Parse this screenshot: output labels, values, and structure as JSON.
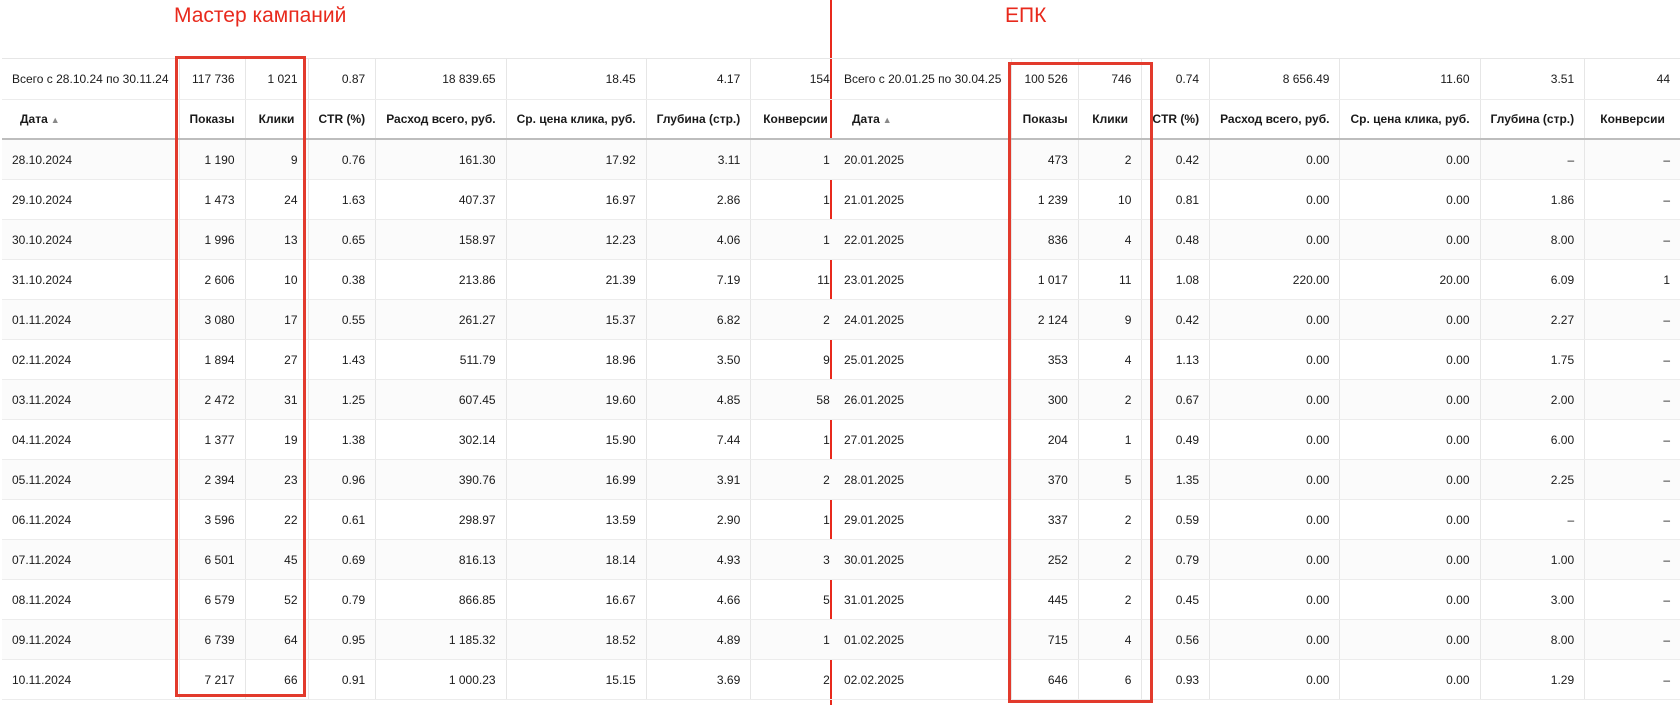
{
  "left": {
    "title": "Мастер кампаний",
    "total": {
      "label": "Всего с 28.10.24 по 30.11.24",
      "values": [
        "117 736",
        "1 021",
        "0.87",
        "18 839.65",
        "18.45",
        "4.17",
        "154"
      ]
    },
    "headers": [
      "Дата",
      "Показы",
      "Клики",
      "CTR (%)",
      "Расход всего, руб.",
      "Ср. цена клика, руб.",
      "Глубина (стр.)",
      "Конверсии"
    ],
    "rows": [
      [
        "28.10.2024",
        "1 190",
        "9",
        "0.76",
        "161.30",
        "17.92",
        "3.11",
        "1"
      ],
      [
        "29.10.2024",
        "1 473",
        "24",
        "1.63",
        "407.37",
        "16.97",
        "2.86",
        "1"
      ],
      [
        "30.10.2024",
        "1 996",
        "13",
        "0.65",
        "158.97",
        "12.23",
        "4.06",
        "1"
      ],
      [
        "31.10.2024",
        "2 606",
        "10",
        "0.38",
        "213.86",
        "21.39",
        "7.19",
        "11"
      ],
      [
        "01.11.2024",
        "3 080",
        "17",
        "0.55",
        "261.27",
        "15.37",
        "6.82",
        "2"
      ],
      [
        "02.11.2024",
        "1 894",
        "27",
        "1.43",
        "511.79",
        "18.96",
        "3.50",
        "9"
      ],
      [
        "03.11.2024",
        "2 472",
        "31",
        "1.25",
        "607.45",
        "19.60",
        "4.85",
        "58"
      ],
      [
        "04.11.2024",
        "1 377",
        "19",
        "1.38",
        "302.14",
        "15.90",
        "7.44",
        "1"
      ],
      [
        "05.11.2024",
        "2 394",
        "23",
        "0.96",
        "390.76",
        "16.99",
        "3.91",
        "2"
      ],
      [
        "06.11.2024",
        "3 596",
        "22",
        "0.61",
        "298.97",
        "13.59",
        "2.90",
        "1"
      ],
      [
        "07.11.2024",
        "6 501",
        "45",
        "0.69",
        "816.13",
        "18.14",
        "4.93",
        "3"
      ],
      [
        "08.11.2024",
        "6 579",
        "52",
        "0.79",
        "866.85",
        "16.67",
        "4.66",
        "5"
      ],
      [
        "09.11.2024",
        "6 739",
        "64",
        "0.95",
        "1 185.32",
        "18.52",
        "4.89",
        "1"
      ],
      [
        "10.11.2024",
        "7 217",
        "66",
        "0.91",
        "1 000.23",
        "15.15",
        "3.69",
        "2"
      ]
    ]
  },
  "right": {
    "title": "ЕПК",
    "total": {
      "label": "Всего с 20.01.25 по 30.04.25",
      "values": [
        "100 526",
        "746",
        "0.74",
        "8 656.49",
        "11.60",
        "3.51",
        "44"
      ]
    },
    "headers": [
      "Дата",
      "Показы",
      "Клики",
      "CTR (%)",
      "Расход всего, руб.",
      "Ср. цена клика, руб.",
      "Глубина (стр.)",
      "Конверсии"
    ],
    "rows": [
      [
        "20.01.2025",
        "473",
        "2",
        "0.42",
        "0.00",
        "0.00",
        "–",
        "–"
      ],
      [
        "21.01.2025",
        "1 239",
        "10",
        "0.81",
        "0.00",
        "0.00",
        "1.86",
        "–"
      ],
      [
        "22.01.2025",
        "836",
        "4",
        "0.48",
        "0.00",
        "0.00",
        "8.00",
        "–"
      ],
      [
        "23.01.2025",
        "1 017",
        "11",
        "1.08",
        "220.00",
        "20.00",
        "6.09",
        "1"
      ],
      [
        "24.01.2025",
        "2 124",
        "9",
        "0.42",
        "0.00",
        "0.00",
        "2.27",
        "–"
      ],
      [
        "25.01.2025",
        "353",
        "4",
        "1.13",
        "0.00",
        "0.00",
        "1.75",
        "–"
      ],
      [
        "26.01.2025",
        "300",
        "2",
        "0.67",
        "0.00",
        "0.00",
        "2.00",
        "–"
      ],
      [
        "27.01.2025",
        "204",
        "1",
        "0.49",
        "0.00",
        "0.00",
        "6.00",
        "–"
      ],
      [
        "28.01.2025",
        "370",
        "5",
        "1.35",
        "0.00",
        "0.00",
        "2.25",
        "–"
      ],
      [
        "29.01.2025",
        "337",
        "2",
        "0.59",
        "0.00",
        "0.00",
        "–",
        "–"
      ],
      [
        "30.01.2025",
        "252",
        "2",
        "0.79",
        "0.00",
        "0.00",
        "1.00",
        "–"
      ],
      [
        "31.01.2025",
        "445",
        "2",
        "0.45",
        "0.00",
        "0.00",
        "3.00",
        "–"
      ],
      [
        "01.02.2025",
        "715",
        "4",
        "0.56",
        "0.00",
        "0.00",
        "8.00",
        "–"
      ],
      [
        "02.02.2025",
        "646",
        "6",
        "0.93",
        "0.00",
        "0.00",
        "1.29",
        "–"
      ]
    ]
  },
  "icons": {
    "sort": "sort-ascending-icon"
  },
  "colors": {
    "annotation": "#e8291c"
  }
}
